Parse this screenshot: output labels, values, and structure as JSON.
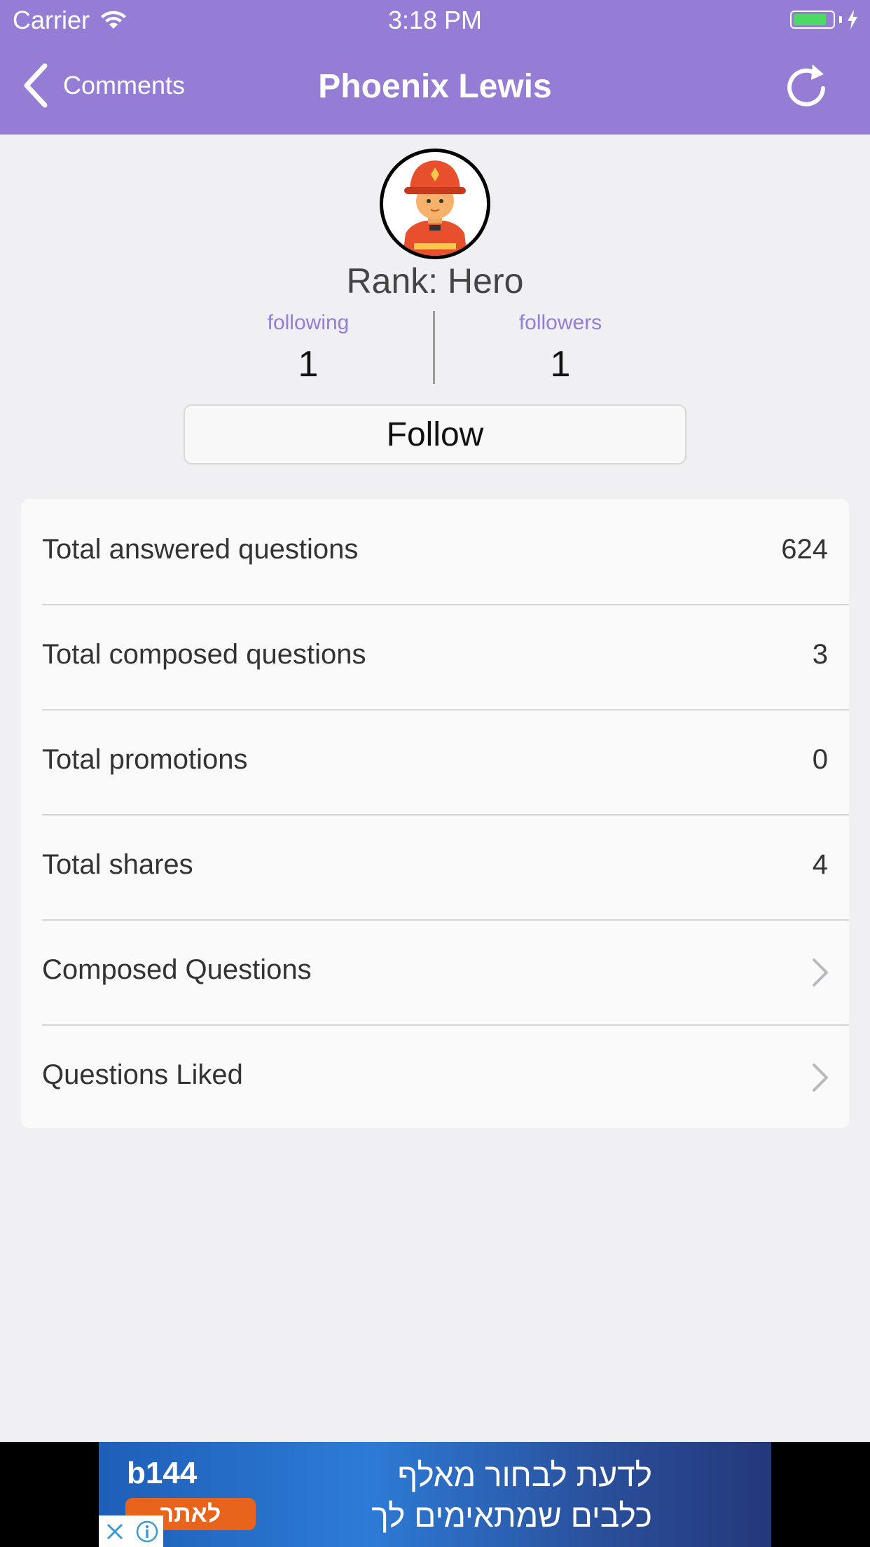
{
  "status_bar": {
    "carrier": "Carrier",
    "time": "3:18 PM",
    "battery_level": 0.85,
    "battery_color": "#4cd964"
  },
  "nav": {
    "back_label": "Comments",
    "title": "Phoenix Lewis",
    "refresh_icon": "refresh-icon",
    "background_color": "#957dd5"
  },
  "profile": {
    "avatar_icon": "firefighter-avatar",
    "rank": "Rank: Hero",
    "following_label": "following",
    "following_count": "1",
    "followers_label": "followers",
    "followers_count": "1",
    "follow_label": "Follow"
  },
  "stats": [
    {
      "label": "Total answered questions",
      "value": "624"
    },
    {
      "label": "Total composed questions",
      "value": "3"
    },
    {
      "label": "Total promotions",
      "value": "0"
    },
    {
      "label": "Total shares",
      "value": "4"
    }
  ],
  "links": [
    {
      "label": "Composed Questions",
      "icon": "chevron-right-icon"
    },
    {
      "label": "Questions Liked",
      "icon": "chevron-right-icon"
    }
  ],
  "ad": {
    "brand": "b144",
    "cta": "לאתר",
    "line1": "לדעת לבחור מאלף",
    "line2": "כלבים שמתאימים לך",
    "cta_color": "#e8641c"
  }
}
